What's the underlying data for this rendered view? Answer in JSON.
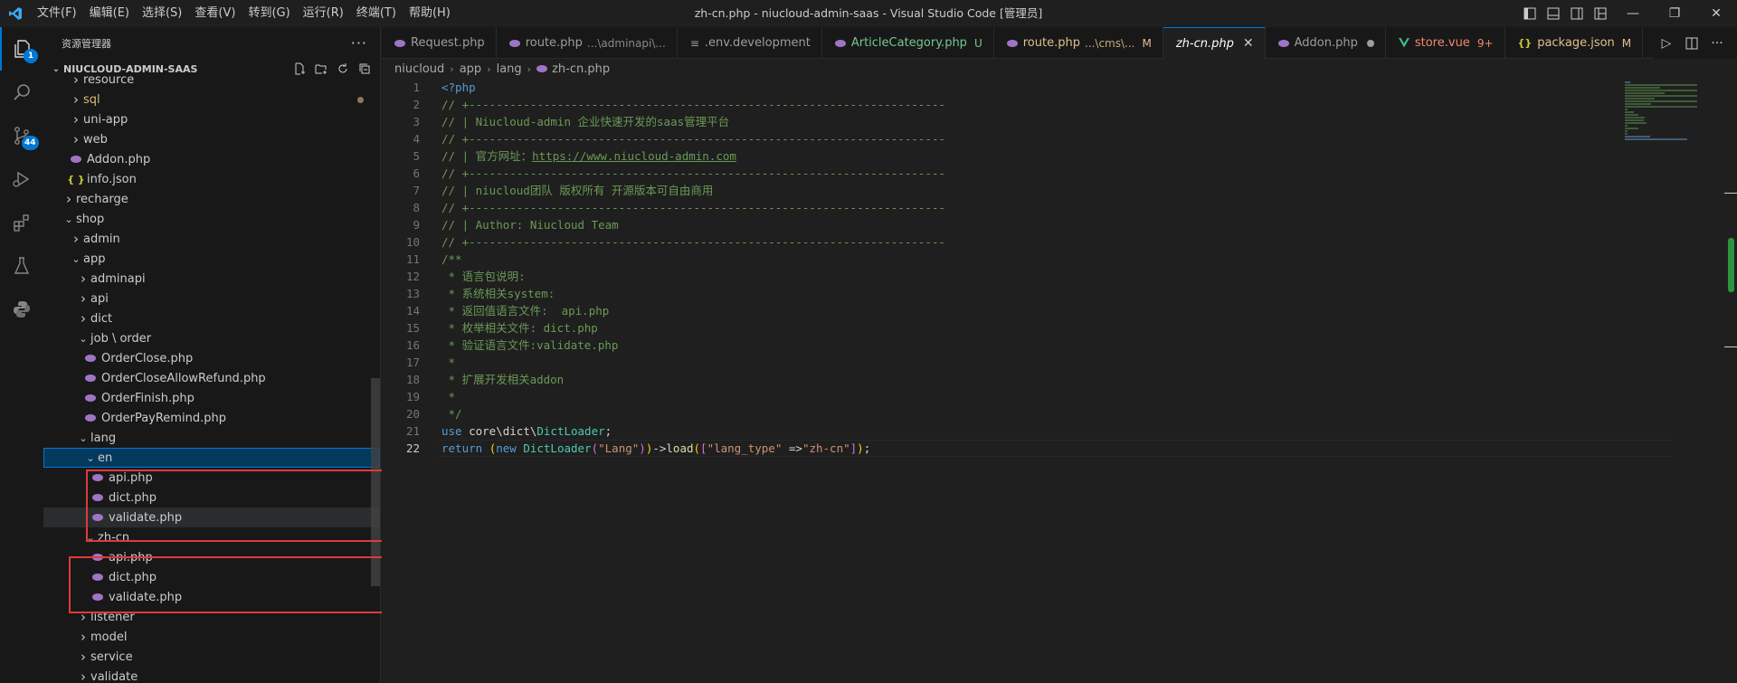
{
  "titlebar": {
    "menu": [
      "文件(F)",
      "编辑(E)",
      "选择(S)",
      "查看(V)",
      "转到(G)",
      "运行(R)",
      "终端(T)",
      "帮助(H)"
    ],
    "title": "zh-cn.php - niucloud-admin-saas - Visual Studio Code [管理员]"
  },
  "activity": {
    "explorer_badge": "1",
    "scm_badge": "44"
  },
  "sidebar": {
    "header": "资源管理器",
    "project": "NIUCLOUD-ADMIN-SAAS",
    "tree": [
      {
        "label": "resource",
        "type": "folder",
        "open": false,
        "level": 2
      },
      {
        "label": "sql",
        "type": "folder",
        "open": false,
        "level": 2,
        "modified": true
      },
      {
        "label": "uni-app",
        "type": "folder",
        "open": false,
        "level": 2
      },
      {
        "label": "web",
        "type": "folder",
        "open": false,
        "level": 2
      },
      {
        "label": "Addon.php",
        "type": "php",
        "level": 2
      },
      {
        "label": "info.json",
        "type": "json",
        "level": 2
      },
      {
        "label": "recharge",
        "type": "folder",
        "open": false,
        "level": 1
      },
      {
        "label": "shop",
        "type": "folder",
        "open": true,
        "level": 1
      },
      {
        "label": "admin",
        "type": "folder",
        "open": false,
        "level": 2
      },
      {
        "label": "app",
        "type": "folder",
        "open": true,
        "level": 2
      },
      {
        "label": "adminapi",
        "type": "folder",
        "open": false,
        "level": 3
      },
      {
        "label": "api",
        "type": "folder",
        "open": false,
        "level": 3
      },
      {
        "label": "dict",
        "type": "folder",
        "open": false,
        "level": 3
      },
      {
        "label": "job \\ order",
        "type": "folder",
        "open": true,
        "level": 3
      },
      {
        "label": "OrderClose.php",
        "type": "php",
        "level": 4
      },
      {
        "label": "OrderCloseAllowRefund.php",
        "type": "php",
        "level": 4
      },
      {
        "label": "OrderFinish.php",
        "type": "php",
        "level": 4
      },
      {
        "label": "OrderPayRemind.php",
        "type": "php",
        "level": 4
      },
      {
        "label": "lang",
        "type": "folder",
        "open": true,
        "level": 3
      },
      {
        "label": "en",
        "type": "folder",
        "open": true,
        "level": 4,
        "selected": true
      },
      {
        "label": "api.php",
        "type": "php",
        "level": 5
      },
      {
        "label": "dict.php",
        "type": "php",
        "level": 5
      },
      {
        "label": "validate.php",
        "type": "php",
        "level": 5,
        "hovered": true
      },
      {
        "label": "zh-cn",
        "type": "folder",
        "open": true,
        "level": 4
      },
      {
        "label": "api.php",
        "type": "php",
        "level": 5
      },
      {
        "label": "dict.php",
        "type": "php",
        "level": 5
      },
      {
        "label": "validate.php",
        "type": "php",
        "level": 5
      },
      {
        "label": "listener",
        "type": "folder",
        "open": false,
        "level": 3
      },
      {
        "label": "model",
        "type": "folder",
        "open": false,
        "level": 3
      },
      {
        "label": "service",
        "type": "folder",
        "open": false,
        "level": 3
      },
      {
        "label": "validate",
        "type": "folder",
        "open": false,
        "level": 3
      }
    ]
  },
  "tabs": [
    {
      "label": "Request.php",
      "icon": "php",
      "color": "#9d9d9d"
    },
    {
      "label": "route.php",
      "desc": "...\\adminapi\\...",
      "icon": "php",
      "color": "#9d9d9d"
    },
    {
      "label": ".env.development",
      "icon": "lines",
      "color": "#9d9d9d"
    },
    {
      "label": "ArticleCategory.php",
      "status": "U",
      "icon": "php",
      "color": "#73c991"
    },
    {
      "label": "route.php",
      "desc": "...\\cms\\...",
      "status": "M",
      "icon": "php",
      "color": "#e2c08d"
    },
    {
      "label": "zh-cn.php",
      "icon": "none",
      "color": "#ffffff",
      "active": true
    },
    {
      "label": "Addon.php",
      "icon": "php",
      "color": "#9d9d9d",
      "dirty": true
    },
    {
      "label": "store.vue",
      "status": "9+",
      "icon": "vue",
      "color": "#f48771"
    },
    {
      "label": "package.json",
      "status": "M",
      "icon": "json",
      "color": "#e2c08d"
    }
  ],
  "breadcrumb": [
    "niucloud",
    "app",
    "lang",
    "zh-cn.php"
  ],
  "editor": {
    "current_line": 22,
    "lines": [
      [
        {
          "t": "<?php",
          "c": "c-meta"
        }
      ],
      [
        {
          "t": "// +----------------------------------------------------------------------",
          "c": "c-cm"
        }
      ],
      [
        {
          "t": "// | Niucloud-admin 企业快速开发的saas管理平台",
          "c": "c-cm"
        }
      ],
      [
        {
          "t": "// +----------------------------------------------------------------------",
          "c": "c-cm"
        }
      ],
      [
        {
          "t": "// | 官方网址：",
          "c": "c-cm"
        },
        {
          "t": "https://www.niucloud-admin.com",
          "c": "c-url"
        }
      ],
      [
        {
          "t": "// +----------------------------------------------------------------------",
          "c": "c-cm"
        }
      ],
      [
        {
          "t": "// | niucloud团队 版权所有 开源版本可自由商用",
          "c": "c-cm"
        }
      ],
      [
        {
          "t": "// +----------------------------------------------------------------------",
          "c": "c-cm"
        }
      ],
      [
        {
          "t": "// | Author: Niucloud Team",
          "c": "c-cm"
        }
      ],
      [
        {
          "t": "// +----------------------------------------------------------------------",
          "c": "c-cm"
        }
      ],
      [
        {
          "t": "/**",
          "c": "c-cm"
        }
      ],
      [
        {
          "t": " * 语言包说明:",
          "c": "c-cm"
        }
      ],
      [
        {
          "t": " * 系统相关system:",
          "c": "c-cm"
        }
      ],
      [
        {
          "t": " * 返回值语言文件:  api.php",
          "c": "c-cm"
        }
      ],
      [
        {
          "t": " * 枚举相关文件: dict.php",
          "c": "c-cm"
        }
      ],
      [
        {
          "t": " * 验证语言文件:validate.php",
          "c": "c-cm"
        }
      ],
      [
        {
          "t": " *",
          "c": "c-cm"
        }
      ],
      [
        {
          "t": " * 扩展开发相关addon",
          "c": "c-cm"
        }
      ],
      [
        {
          "t": " *",
          "c": "c-cm"
        }
      ],
      [
        {
          "t": " */",
          "c": "c-cm"
        }
      ],
      [
        {
          "t": "use ",
          "c": "c-kw"
        },
        {
          "t": "core\\dict\\",
          "c": "c-txt"
        },
        {
          "t": "DictLoader",
          "c": "c-cls"
        },
        {
          "t": ";",
          "c": "c-txt"
        }
      ],
      [
        {
          "t": "return ",
          "c": "c-kw"
        },
        {
          "t": "(",
          "c": "c-br1"
        },
        {
          "t": "new ",
          "c": "c-kw"
        },
        {
          "t": "DictLoader",
          "c": "c-cls"
        },
        {
          "t": "(",
          "c": "c-br2"
        },
        {
          "t": "\"Lang\"",
          "c": "c-str"
        },
        {
          "t": ")",
          "c": "c-br2"
        },
        {
          "t": ")",
          "c": "c-br1"
        },
        {
          "t": "->",
          "c": "c-txt"
        },
        {
          "t": "load",
          "c": "c-fn"
        },
        {
          "t": "(",
          "c": "c-br1"
        },
        {
          "t": "[",
          "c": "c-br2"
        },
        {
          "t": "\"lang_type\"",
          "c": "c-str"
        },
        {
          "t": " =>",
          "c": "c-txt"
        },
        {
          "t": "\"zh-cn\"",
          "c": "c-str"
        },
        {
          "t": "]",
          "c": "c-br2"
        },
        {
          "t": ")",
          "c": "c-br1"
        },
        {
          "t": ";",
          "c": "c-txt"
        }
      ]
    ]
  }
}
